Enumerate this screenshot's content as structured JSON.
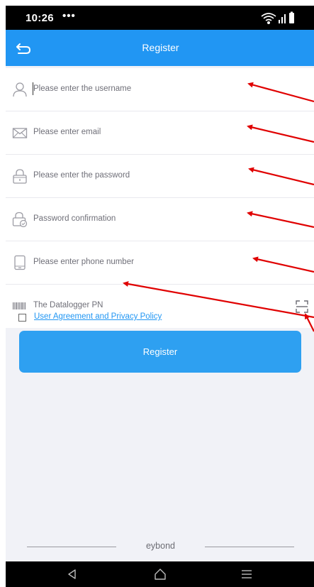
{
  "status_bar": {
    "time": "10:26",
    "dots": "•••"
  },
  "nav": {
    "title": "Register"
  },
  "form": {
    "fields": [
      {
        "placeholder": "Please enter the username",
        "icon": "user-icon",
        "value": ""
      },
      {
        "placeholder": "Please enter email",
        "icon": "mail-icon",
        "value": ""
      },
      {
        "placeholder": "Please enter the password",
        "icon": "lock-icon",
        "value": ""
      },
      {
        "placeholder": "Password confirmation",
        "icon": "lock-check-icon",
        "value": ""
      },
      {
        "placeholder": "Please enter phone number",
        "icon": "phone-icon",
        "value": ""
      },
      {
        "placeholder": "The Datalogger PN",
        "icon": "barcode-icon",
        "value": ""
      }
    ]
  },
  "agreement": {
    "label": "User Agreement and Privacy Policy",
    "checked": false
  },
  "register_button": {
    "label": "Register"
  },
  "footer": {
    "brand": "eybond"
  },
  "colors": {
    "accent": "#2196f3",
    "button": "#2ea0f1",
    "background": "#f1f2f7",
    "annotation_arrow": "#e00000"
  }
}
